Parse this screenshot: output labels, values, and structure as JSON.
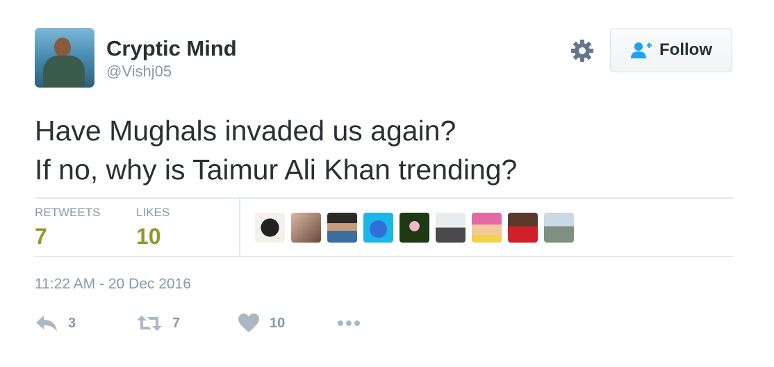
{
  "user": {
    "name": "Cryptic Mind",
    "handle": "@Vishj05"
  },
  "follow_button": {
    "label": "Follow"
  },
  "tweet": {
    "line1": "Have Mughals invaded us again?",
    "line2": "If no, why is Taimur Ali Khan trending?"
  },
  "stats": {
    "retweets_label": "RETWEETS",
    "retweets_value": "7",
    "likes_label": "LIKES",
    "likes_value": "10"
  },
  "likers_count": 9,
  "timestamp": "11:22 AM - 20 Dec 2016",
  "actions": {
    "reply_count": "3",
    "retweet_count": "7",
    "like_count": "10"
  },
  "colors": {
    "stat_value": "#8f9a2e",
    "muted_text": "#8899a6",
    "follow_icon": "#1da1f2",
    "action_icon": "#aab8c2"
  },
  "icons": [
    "gear-icon",
    "add-user-icon",
    "reply-icon",
    "retweet-icon",
    "heart-icon",
    "more-icon"
  ]
}
